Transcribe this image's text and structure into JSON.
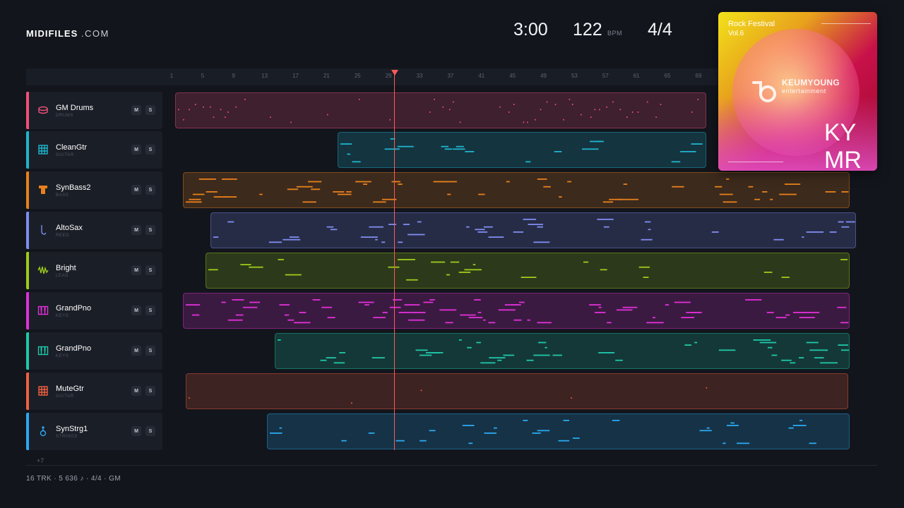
{
  "brand": {
    "name": "MIDIFILES",
    "domain": ".COM"
  },
  "stats": {
    "duration": "3:00",
    "tempo": "122",
    "tempo_unit": "BPM",
    "time_signature": "4/4"
  },
  "ruler": {
    "labels": [
      "1",
      "5",
      "9",
      "13",
      "17",
      "21",
      "25",
      "29",
      "33",
      "37",
      "41",
      "45",
      "49",
      "53",
      "57",
      "61",
      "65",
      "69"
    ]
  },
  "playhead": {
    "bar": 29,
    "color": "#ff5a5a"
  },
  "tracks": [
    {
      "name": "GM Drums",
      "category": "DRUMS",
      "color": "#f0507a",
      "icon": "drum-icon",
      "mute": "M",
      "solo": "S"
    },
    {
      "name": "CleanGtr",
      "category": "GUITAR",
      "color": "#1fb4cc",
      "icon": "guitar-fretboard-icon",
      "mute": "M",
      "solo": "S"
    },
    {
      "name": "SynBass2",
      "category": "BASS",
      "color": "#e8801c",
      "icon": "bass-icon",
      "mute": "M",
      "solo": "S"
    },
    {
      "name": "AltoSax",
      "category": "REED",
      "color": "#7f8cf0",
      "icon": "saxophone-icon",
      "mute": "M",
      "solo": "S"
    },
    {
      "name": "Bright",
      "category": "LEAD",
      "color": "#9ccc1a",
      "icon": "waveform-icon",
      "mute": "M",
      "solo": "S"
    },
    {
      "name": "GrandPno",
      "category": "KEYS",
      "color": "#e030d8",
      "icon": "piano-icon",
      "mute": "M",
      "solo": "S"
    },
    {
      "name": "GrandPno",
      "category": "KEYS",
      "color": "#1fc8a8",
      "icon": "piano-icon",
      "mute": "M",
      "solo": "S"
    },
    {
      "name": "MuteGtr",
      "category": "GUITAR",
      "color": "#f06040",
      "icon": "guitar-fretboard-icon",
      "mute": "M",
      "solo": "S"
    },
    {
      "name": "SynStrg1",
      "category": "STRINGS",
      "color": "#2aa8f0",
      "icon": "violin-icon",
      "mute": "M",
      "solo": "S"
    }
  ],
  "more_tracks": "+7",
  "album": {
    "title_line1": "Rock Festival",
    "title_line2": "Vol.6",
    "label_line1": "KEUMYOUNG",
    "label_line2": "entertainment",
    "monogram_line1": "KY",
    "monogram_line2": "MR"
  },
  "footer": "16 TRK  ·  5 636 ♪  ·  4/4  ·  GM"
}
